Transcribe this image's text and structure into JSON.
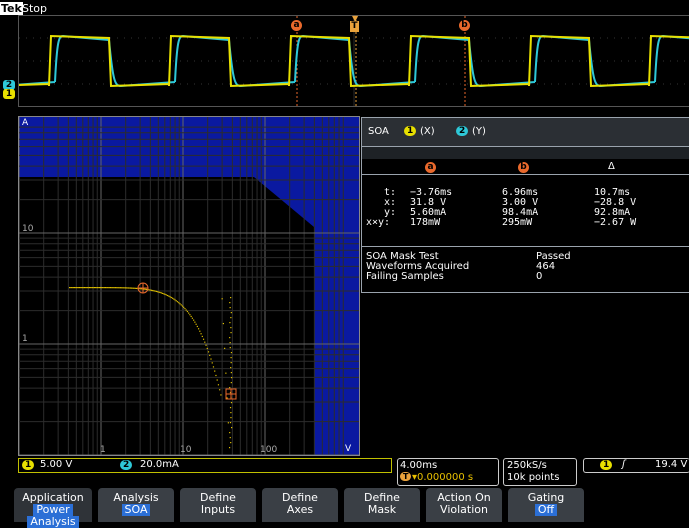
{
  "header": {
    "brand": "Tek",
    "status": "Stop"
  },
  "markers": {
    "a": "a",
    "b": "b",
    "trigger": "T"
  },
  "channels": {
    "ch1": "1",
    "ch2": "2"
  },
  "plot": {
    "label_a": "A",
    "label_v": "V",
    "y_ticks": [
      "10",
      "1"
    ],
    "x_ticks": [
      "1",
      "10",
      "100"
    ]
  },
  "soa": {
    "title": "SOA",
    "ch1_label": "(X)",
    "ch2_label": "(Y)",
    "col_a": "a",
    "col_b": "b",
    "col_delta": "Δ",
    "rows": [
      {
        "label": "t:",
        "a": "−3.76ms",
        "b": "6.96ms",
        "d": "10.7ms"
      },
      {
        "label": "x:",
        "a": "31.8 V",
        "b": "3.00 V",
        "d": "−28.8 V"
      },
      {
        "label": "y:",
        "a": "5.60mA",
        "b": "98.4mA",
        "d": "92.8mA"
      },
      {
        "label": "x×y:",
        "a": "178mW",
        "b": "295mW",
        "d": "−2.67 W"
      }
    ],
    "mask_test_label": "SOA Mask Test",
    "mask_test_value": "Passed",
    "acquired_label": "Waveforms Acquired",
    "acquired_value": "464",
    "failing_label": "Failing Samples",
    "failing_value": "0"
  },
  "scales": {
    "ch1": "5.00 V",
    "ch2": "20.0mA",
    "timebase": "4.00ms",
    "trigger_pos": "▾0.000000 s",
    "rate": "250kS/s",
    "record": "10k points",
    "trig_ch": "1",
    "trig_slope": "ʃ",
    "trig_level": "19.4 V"
  },
  "menu": [
    {
      "line1": "Application",
      "line2": "Power",
      "line3": "Analysis"
    },
    {
      "line1": "Analysis",
      "line2": "SOA"
    },
    {
      "line1": "Define",
      "line2": "Inputs"
    },
    {
      "line1": "Define",
      "line2": "Axes"
    },
    {
      "line1": "Define",
      "line2": "Mask"
    },
    {
      "line1": "Action On",
      "line2": "Violation"
    },
    {
      "line1": "Gating",
      "line2": "Off"
    }
  ],
  "colors": {
    "ch1": "#e8e000",
    "ch2": "#2ec8d8",
    "mask": "#0a19a0",
    "cursor": "#e9692c"
  }
}
